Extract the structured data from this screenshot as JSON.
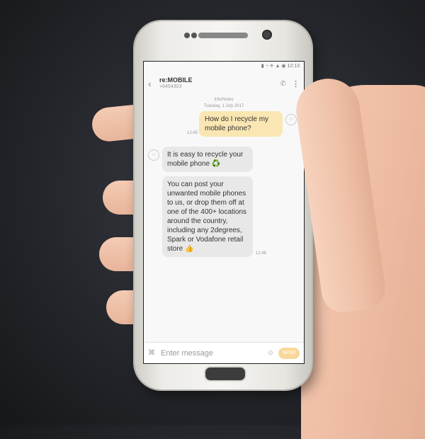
{
  "status_bar": {
    "icons_text": "▮ ◔ ✈ ▲ ◉ 12:13"
  },
  "chat_header": {
    "contact_name": "re:MOBILE",
    "contact_number": "+6454303",
    "back_icon": "chevron-left-icon",
    "call_icon": "phone-icon",
    "more_icon": "more-vertical-icon"
  },
  "thread": {
    "meta_top": "Info/Notes",
    "date": "Tuesday, 1 July 2017",
    "outgoing": [
      {
        "text": "How do I recycle my mobile phone?",
        "time": "12:45"
      }
    ],
    "incoming": [
      {
        "text": "It is easy to recycle your mobile phone ♻️"
      },
      {
        "text": "You can post your unwanted mobile phones to us, or drop them off at one of the 400+ locations around the country, including any 2degrees, Spark or Vodafone retail store 👍"
      }
    ],
    "incoming_time": "12:46"
  },
  "composer": {
    "placeholder": "Enter message",
    "send_label": "SEND",
    "attach_icon": "paperclip-icon",
    "emoji_icon": "emoji-icon"
  },
  "colors": {
    "outgoing_bubble": "#f9e6b2",
    "incoming_bubble": "#e8e8e8",
    "send_button": "#f8d79a"
  }
}
